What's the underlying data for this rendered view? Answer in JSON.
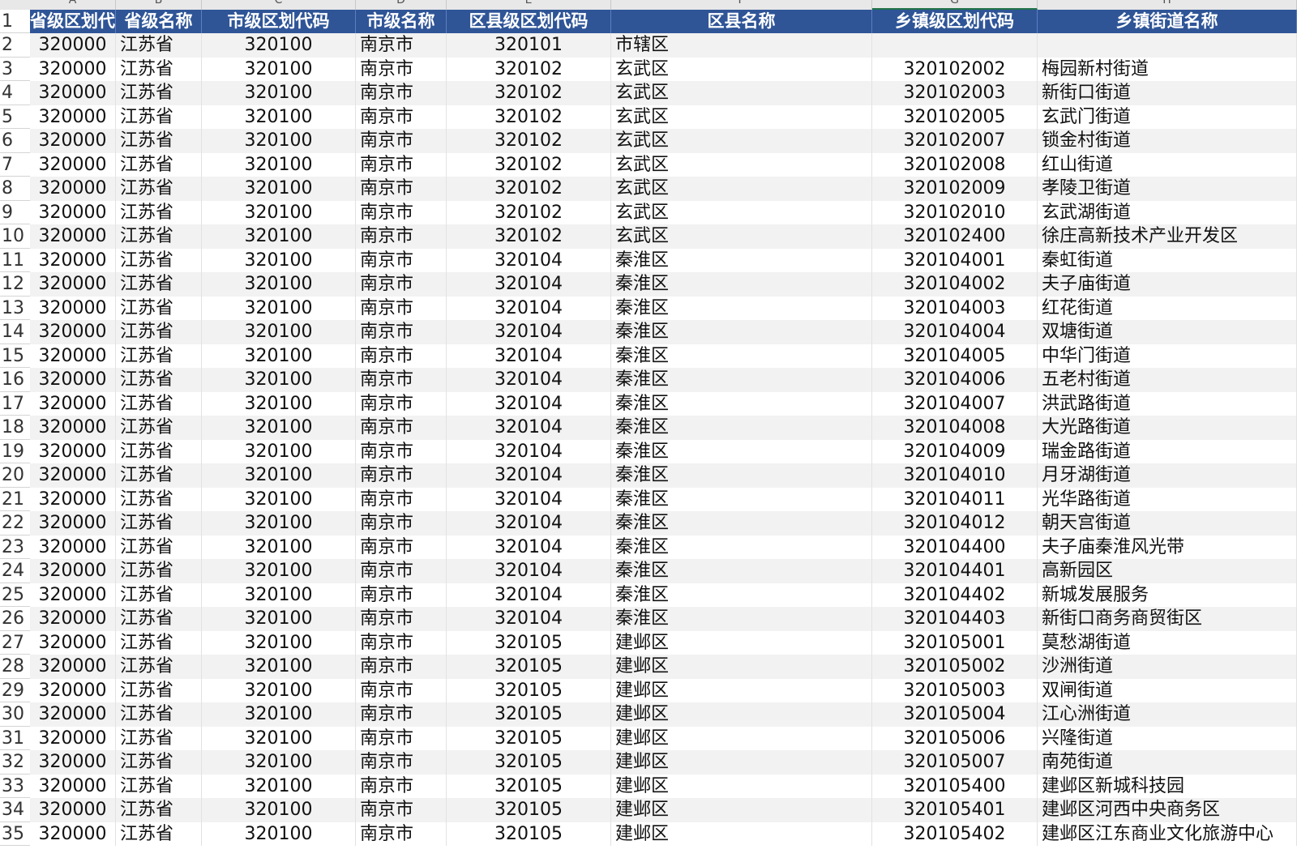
{
  "column_letters": [
    "A",
    "B",
    "C",
    "D",
    "E",
    "F",
    "G",
    "H"
  ],
  "selected_column": "G",
  "headers": [
    "省级区划代码",
    "省级名称",
    "市级区划代码",
    "市级名称",
    "区县级区划代码",
    "区县名称",
    "乡镇级区划代码",
    "乡镇街道名称"
  ],
  "header_row_number": "1",
  "rows": [
    {
      "n": "2",
      "c": [
        "320000",
        "江苏省",
        "320100",
        "南京市",
        "320101",
        "市辖区",
        "",
        ""
      ]
    },
    {
      "n": "3",
      "c": [
        "320000",
        "江苏省",
        "320100",
        "南京市",
        "320102",
        "玄武区",
        "320102002",
        "梅园新村街道"
      ]
    },
    {
      "n": "4",
      "c": [
        "320000",
        "江苏省",
        "320100",
        "南京市",
        "320102",
        "玄武区",
        "320102003",
        "新街口街道"
      ]
    },
    {
      "n": "5",
      "c": [
        "320000",
        "江苏省",
        "320100",
        "南京市",
        "320102",
        "玄武区",
        "320102005",
        "玄武门街道"
      ]
    },
    {
      "n": "6",
      "c": [
        "320000",
        "江苏省",
        "320100",
        "南京市",
        "320102",
        "玄武区",
        "320102007",
        "锁金村街道"
      ]
    },
    {
      "n": "7",
      "c": [
        "320000",
        "江苏省",
        "320100",
        "南京市",
        "320102",
        "玄武区",
        "320102008",
        "红山街道"
      ]
    },
    {
      "n": "8",
      "c": [
        "320000",
        "江苏省",
        "320100",
        "南京市",
        "320102",
        "玄武区",
        "320102009",
        "孝陵卫街道"
      ]
    },
    {
      "n": "9",
      "c": [
        "320000",
        "江苏省",
        "320100",
        "南京市",
        "320102",
        "玄武区",
        "320102010",
        "玄武湖街道"
      ]
    },
    {
      "n": "10",
      "c": [
        "320000",
        "江苏省",
        "320100",
        "南京市",
        "320102",
        "玄武区",
        "320102400",
        "徐庄高新技术产业开发区"
      ]
    },
    {
      "n": "11",
      "c": [
        "320000",
        "江苏省",
        "320100",
        "南京市",
        "320104",
        "秦淮区",
        "320104001",
        "秦虹街道"
      ]
    },
    {
      "n": "12",
      "c": [
        "320000",
        "江苏省",
        "320100",
        "南京市",
        "320104",
        "秦淮区",
        "320104002",
        "夫子庙街道"
      ]
    },
    {
      "n": "13",
      "c": [
        "320000",
        "江苏省",
        "320100",
        "南京市",
        "320104",
        "秦淮区",
        "320104003",
        "红花街道"
      ]
    },
    {
      "n": "14",
      "c": [
        "320000",
        "江苏省",
        "320100",
        "南京市",
        "320104",
        "秦淮区",
        "320104004",
        "双塘街道"
      ]
    },
    {
      "n": "15",
      "c": [
        "320000",
        "江苏省",
        "320100",
        "南京市",
        "320104",
        "秦淮区",
        "320104005",
        "中华门街道"
      ]
    },
    {
      "n": "16",
      "c": [
        "320000",
        "江苏省",
        "320100",
        "南京市",
        "320104",
        "秦淮区",
        "320104006",
        "五老村街道"
      ]
    },
    {
      "n": "17",
      "c": [
        "320000",
        "江苏省",
        "320100",
        "南京市",
        "320104",
        "秦淮区",
        "320104007",
        "洪武路街道"
      ]
    },
    {
      "n": "18",
      "c": [
        "320000",
        "江苏省",
        "320100",
        "南京市",
        "320104",
        "秦淮区",
        "320104008",
        "大光路街道"
      ]
    },
    {
      "n": "19",
      "c": [
        "320000",
        "江苏省",
        "320100",
        "南京市",
        "320104",
        "秦淮区",
        "320104009",
        "瑞金路街道"
      ]
    },
    {
      "n": "20",
      "c": [
        "320000",
        "江苏省",
        "320100",
        "南京市",
        "320104",
        "秦淮区",
        "320104010",
        "月牙湖街道"
      ]
    },
    {
      "n": "21",
      "c": [
        "320000",
        "江苏省",
        "320100",
        "南京市",
        "320104",
        "秦淮区",
        "320104011",
        "光华路街道"
      ]
    },
    {
      "n": "22",
      "c": [
        "320000",
        "江苏省",
        "320100",
        "南京市",
        "320104",
        "秦淮区",
        "320104012",
        "朝天宫街道"
      ]
    },
    {
      "n": "23",
      "c": [
        "320000",
        "江苏省",
        "320100",
        "南京市",
        "320104",
        "秦淮区",
        "320104400",
        "夫子庙秦淮风光带"
      ]
    },
    {
      "n": "24",
      "c": [
        "320000",
        "江苏省",
        "320100",
        "南京市",
        "320104",
        "秦淮区",
        "320104401",
        "高新园区"
      ]
    },
    {
      "n": "25",
      "c": [
        "320000",
        "江苏省",
        "320100",
        "南京市",
        "320104",
        "秦淮区",
        "320104402",
        "新城发展服务"
      ]
    },
    {
      "n": "26",
      "c": [
        "320000",
        "江苏省",
        "320100",
        "南京市",
        "320104",
        "秦淮区",
        "320104403",
        "新街口商务商贸街区"
      ]
    },
    {
      "n": "27",
      "c": [
        "320000",
        "江苏省",
        "320100",
        "南京市",
        "320105",
        "建邺区",
        "320105001",
        "莫愁湖街道"
      ]
    },
    {
      "n": "28",
      "c": [
        "320000",
        "江苏省",
        "320100",
        "南京市",
        "320105",
        "建邺区",
        "320105002",
        "沙洲街道"
      ]
    },
    {
      "n": "29",
      "c": [
        "320000",
        "江苏省",
        "320100",
        "南京市",
        "320105",
        "建邺区",
        "320105003",
        "双闸街道"
      ]
    },
    {
      "n": "30",
      "c": [
        "320000",
        "江苏省",
        "320100",
        "南京市",
        "320105",
        "建邺区",
        "320105004",
        "江心洲街道"
      ]
    },
    {
      "n": "31",
      "c": [
        "320000",
        "江苏省",
        "320100",
        "南京市",
        "320105",
        "建邺区",
        "320105006",
        "兴隆街道"
      ]
    },
    {
      "n": "32",
      "c": [
        "320000",
        "江苏省",
        "320100",
        "南京市",
        "320105",
        "建邺区",
        "320105007",
        "南苑街道"
      ]
    },
    {
      "n": "33",
      "c": [
        "320000",
        "江苏省",
        "320100",
        "南京市",
        "320105",
        "建邺区",
        "320105400",
        "建邺区新城科技园"
      ]
    },
    {
      "n": "34",
      "c": [
        "320000",
        "江苏省",
        "320100",
        "南京市",
        "320105",
        "建邺区",
        "320105401",
        "建邺区河西中央商务区"
      ]
    },
    {
      "n": "35",
      "c": [
        "320000",
        "江苏省",
        "320100",
        "南京市",
        "320105",
        "建邺区",
        "320105402",
        "建邺区江东商业文化旅游中心"
      ]
    }
  ],
  "colors": {
    "header_bg": "#2f5597",
    "header_text": "#ffffff",
    "stripe": "#f2f2f2",
    "selected_col": "#217346"
  }
}
